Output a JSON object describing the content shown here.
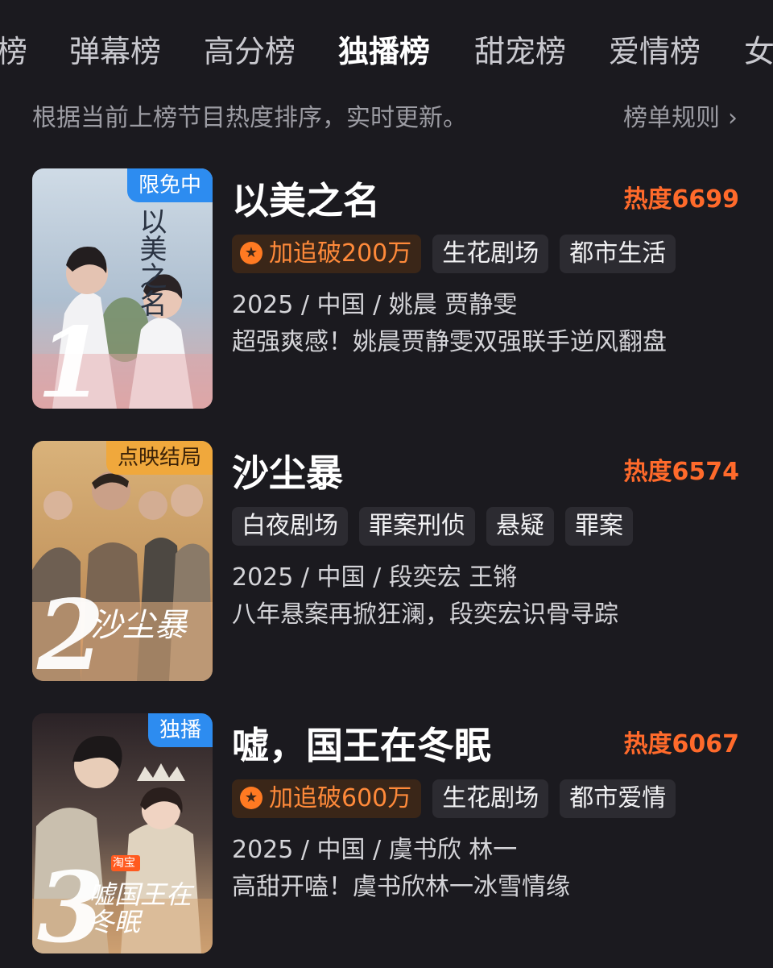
{
  "tabs": [
    "榜",
    "弹幕榜",
    "高分榜",
    "独播榜",
    "甜宠榜",
    "爱情榜",
    "女"
  ],
  "active_tab": "独播榜",
  "subtitle": "根据当前上榜节目热度排序，实时更新。",
  "rules_label": "榜单规则",
  "rules_icon": "chevron-right-icon",
  "accent_color": "#ff6a2b",
  "items": [
    {
      "rank": "1",
      "badge": "限免中",
      "badge_color": "#2d8cf0",
      "poster_title": "以美之名",
      "title": "以美之名",
      "heat": "热度6699",
      "hot_tag": "加追破200万",
      "tags": [
        "生花剧场",
        "都市生活"
      ],
      "meta": "2025 / 中国 / 姚晨 贾静雯",
      "desc": "超强爽感！姚晨贾静雯双强联手逆风翻盘"
    },
    {
      "rank": "2",
      "badge": "点映结局",
      "badge_color": "#f0a83c",
      "poster_title": "沙尘暴",
      "title": "沙尘暴",
      "heat": "热度6574",
      "hot_tag": "",
      "tags": [
        "白夜剧场",
        "罪案刑侦",
        "悬疑",
        "罪案"
      ],
      "meta": "2025 / 中国 / 段奕宏 王锵",
      "desc": "八年悬案再掀狂澜，段奕宏识骨寻踪"
    },
    {
      "rank": "3",
      "badge": "独播",
      "badge_color": "#2d8cf0",
      "poster_title": "嘘国王在冬眠",
      "poster_logo": "淘宝",
      "title": "嘘，国王在冬眠",
      "heat": "热度6067",
      "hot_tag": "加追破600万",
      "tags": [
        "生花剧场",
        "都市爱情"
      ],
      "meta": "2025 / 中国 / 虞书欣 林一",
      "desc": "高甜开嗑！虞书欣林一冰雪情缘"
    }
  ]
}
